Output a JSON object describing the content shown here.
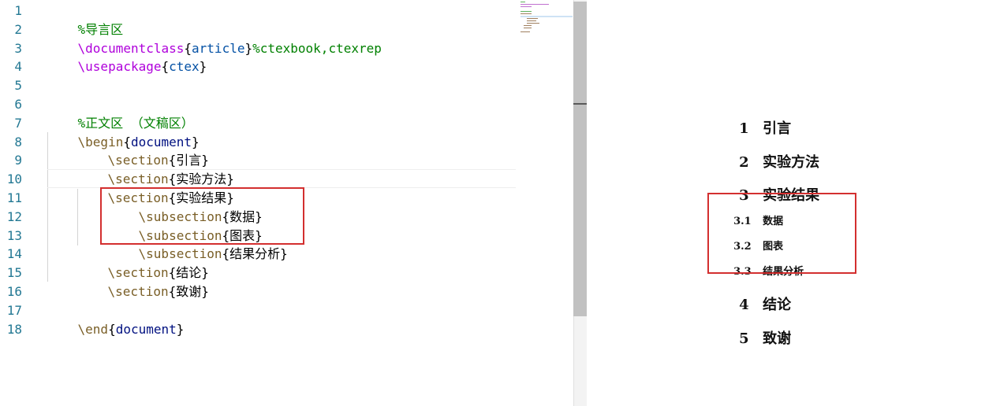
{
  "editor": {
    "line_numbers": [
      "1",
      "2",
      "3",
      "4",
      "5",
      "6",
      "7",
      "8",
      "9",
      "10",
      "11",
      "12",
      "13",
      "14",
      "15",
      "16",
      "17",
      "18"
    ],
    "lines": {
      "l1": {
        "comment": "%导言区"
      },
      "l2": {
        "cmd": "\\documentclass",
        "open": "{",
        "arg": "article",
        "close": "}",
        "comment": "%ctexbook,ctexrep"
      },
      "l3": {
        "cmd": "\\usepackage",
        "open": "{",
        "arg": "ctex",
        "close": "}"
      },
      "l6": {
        "comment": "%正文区 （文稿区）"
      },
      "l7": {
        "cmd": "\\begin",
        "open": "{",
        "arg": "document",
        "close": "}"
      },
      "l8": {
        "cmd": "\\section",
        "open": "{",
        "arg": "引言",
        "close": "}"
      },
      "l9": {
        "cmd": "\\section",
        "open": "{",
        "arg": "实验方法",
        "close": "}"
      },
      "l10": {
        "cmd": "\\section",
        "open": "{",
        "arg": "实验结果",
        "close": "}"
      },
      "l11": {
        "cmd": "\\subsection",
        "open": "{",
        "arg": "数据",
        "close": "}"
      },
      "l12": {
        "cmd": "\\subsection",
        "open": "{",
        "arg": "图表",
        "close": "}"
      },
      "l13": {
        "cmd": "\\subsection",
        "open": "{",
        "arg": "结果分析",
        "close": "}"
      },
      "l14": {
        "cmd": "\\section",
        "open": "{",
        "arg": "结论",
        "close": "}"
      },
      "l15": {
        "cmd": "\\section",
        "open": "{",
        "arg": "致谢",
        "close": "}"
      },
      "l17": {
        "cmd": "\\end",
        "open": "{",
        "arg": "document",
        "close": "}"
      }
    },
    "current_line": "10",
    "highlight_color": "#d32f2f"
  },
  "preview": {
    "toc": [
      {
        "num": "1",
        "title": "引言",
        "level": "section"
      },
      {
        "num": "2",
        "title": "实验方法",
        "level": "section"
      },
      {
        "num": "3",
        "title": "实验结果",
        "level": "section"
      },
      {
        "num": "3.1",
        "title": "数据",
        "level": "subsection"
      },
      {
        "num": "3.2",
        "title": "图表",
        "level": "subsection"
      },
      {
        "num": "3.3",
        "title": "结果分析",
        "level": "subsection"
      },
      {
        "num": "4",
        "title": "结论",
        "level": "section"
      },
      {
        "num": "5",
        "title": "致谢",
        "level": "section"
      }
    ]
  },
  "colors": {
    "comment": "#008000",
    "keyword_purple": "#af00db",
    "command": "#795e26",
    "argument": "#0451a5",
    "line_number": "#237893",
    "annotation_box": "#d32f2f"
  }
}
